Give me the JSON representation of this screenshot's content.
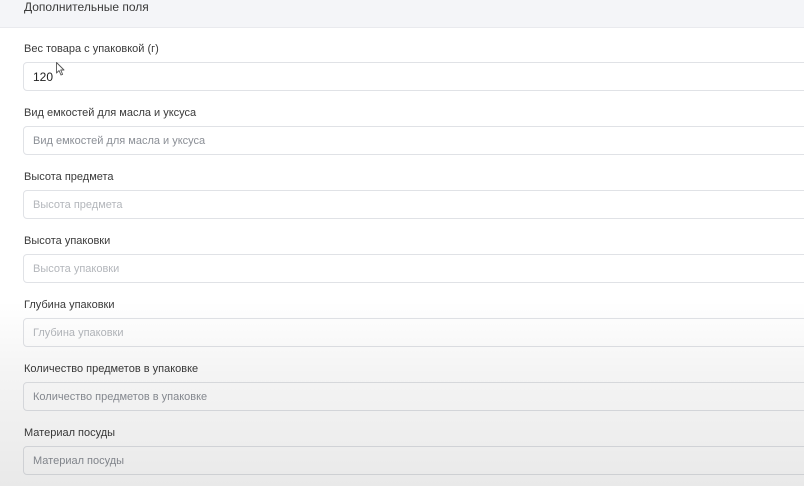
{
  "section": {
    "title": "Дополнительные поля"
  },
  "fields": [
    {
      "label": "Вес товара с упаковкой (г)",
      "value": "120",
      "placeholder": ""
    },
    {
      "label": "Вид емкостей для масла и уксуса",
      "value": "",
      "placeholder": "Вид емкостей для масла и уксуса"
    },
    {
      "label": "Высота предмета",
      "value": "",
      "placeholder": "Высота предмета"
    },
    {
      "label": "Высота упаковки",
      "value": "",
      "placeholder": "Высота упаковки"
    },
    {
      "label": "Глубина упаковки",
      "value": "",
      "placeholder": "Глубина упаковки"
    },
    {
      "label": "Количество предметов в упаковке",
      "value": "",
      "placeholder": "Количество предметов в упаковке"
    },
    {
      "label": "Материал посуды",
      "value": "",
      "placeholder": "Материал посуды"
    }
  ],
  "icons": {
    "cursor": "mouse-pointer-icon"
  }
}
